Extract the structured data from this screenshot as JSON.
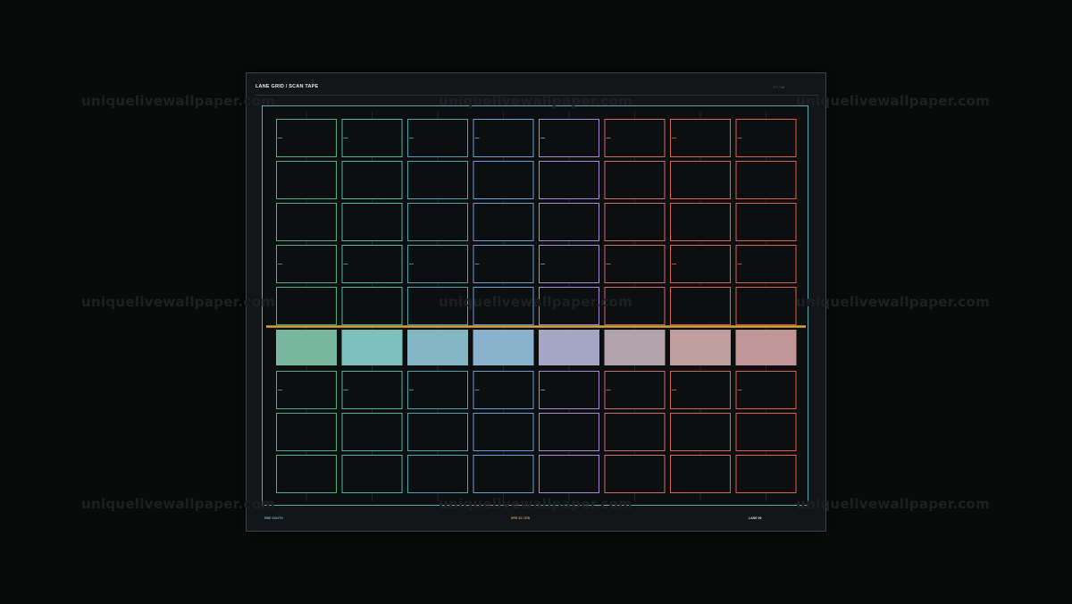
{
  "panel": {
    "title": "LANE GRID  /  SCAN TAPE",
    "meta": "F7 / 08"
  },
  "footer": {
    "left": "RBE SOUTH",
    "center": "SPD 12 / 078",
    "right": "LANE 06"
  },
  "watermark": {
    "text": "uniquelivewallpaper.com"
  },
  "grid": {
    "columns": 8,
    "rows": 9,
    "highlight_row": 6,
    "lane_colors": [
      "#4fae82",
      "#4bb6a3",
      "#4aa3ae",
      "#6a9ed6",
      "#a48bd2",
      "#c86f6e",
      "#d3675d",
      "#dc5f4f"
    ],
    "fill_colors": [
      "#78b6a0",
      "#7cc0bc",
      "#84b5c3",
      "#8ab2cd",
      "#a4a6c4",
      "#b2a2aa",
      "#c09e9e",
      "#c09596"
    ],
    "scan_line_color": "#d9a43a",
    "marked_rows": [
      1,
      4,
      7
    ]
  }
}
